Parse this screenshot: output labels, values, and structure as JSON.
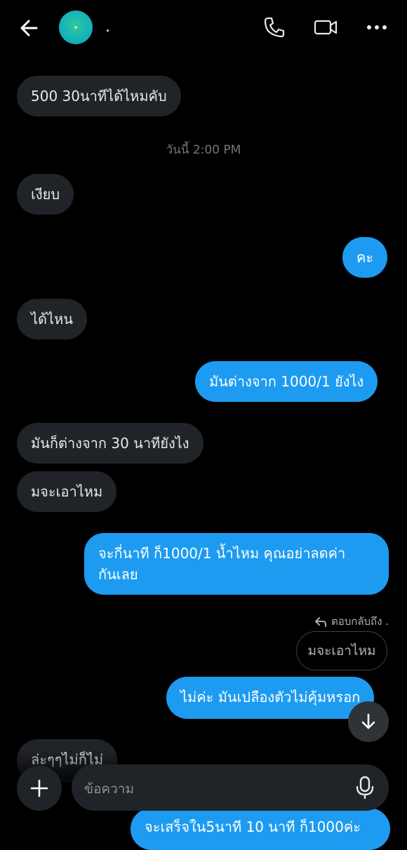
{
  "header": {
    "name": "."
  },
  "messages": {
    "m1": "500 30นาทีได้ไหมคับ",
    "timestamp": "วันนี้ 2:00 PM",
    "m2": "เงียบ",
    "m3": "คะ",
    "m4": "ได้ไหน",
    "m5": "มันต่างจาก 1000/1 ยังไง",
    "m6": "มันก็ต่างจาก 30 นาทียังไง",
    "m7": "มจะเอาไหม",
    "m8_line1": "จะกี่นาที ก็1000/1 น้ำไหม คุณอย่าลดค่า",
    "m8_line2": "กันเลย",
    "reply_label": "ตอบกลับถึง .",
    "quoted": "มจะเอาไหม",
    "m9": "ไม่ค่ะ มันเปลืองตัวไม่คุ้มหรอก",
    "m10": "ล่ะๆๆไม่ก็ไม่",
    "m11": "จะเสร็จใน5นาที 10 นาที ก็1000ค่ะ"
  },
  "composer": {
    "placeholder": "ข้อความ"
  },
  "colors": {
    "outgoing": "#1d9bf0",
    "incoming": "#202327",
    "background": "#000000"
  }
}
